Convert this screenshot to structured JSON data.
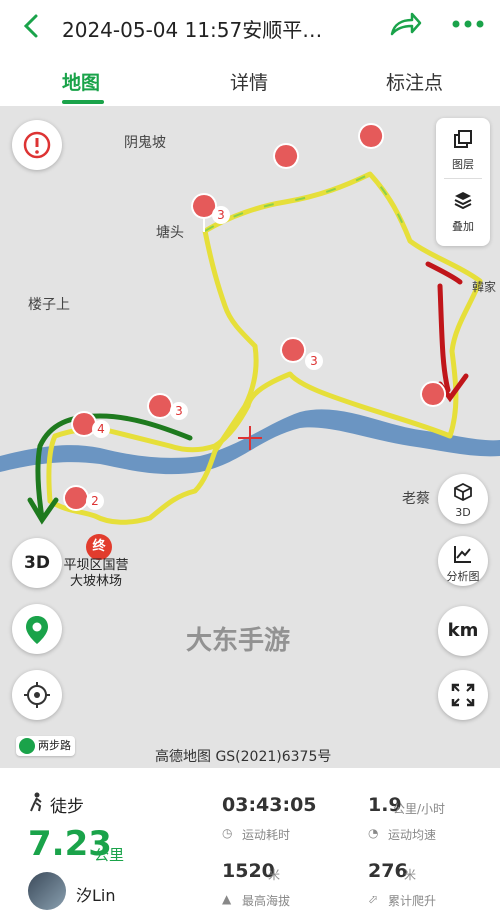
{
  "header": {
    "title": "2024-05-04 11:57安顺平…",
    "back_icon": "chevron-left-icon",
    "share_icon": "share-arrow-icon",
    "more_icon": "more-dots-icon",
    "accent": "#1aa34a"
  },
  "tabs": [
    {
      "label": "地图",
      "active": true
    },
    {
      "label": "详情",
      "active": false
    },
    {
      "label": "标注点",
      "active": false
    }
  ],
  "map": {
    "places": {
      "yinguipo": "阴鬼坡",
      "tangtou": "塘头",
      "louzishang": "楼子上",
      "laocai": "老蔡",
      "jia": "韓家"
    },
    "end_badge": "终",
    "farm_label_line1": "平坝区国营",
    "farm_label_line2": "大坡林场",
    "marker_counts": {
      "m1": "3",
      "m2": "3",
      "m3": "3",
      "m4": "4",
      "m5": "2"
    },
    "layers": {
      "layer_label": "图层",
      "overlay_label": "叠加"
    },
    "right_buttons": {
      "three_d": "3D",
      "analysis": "分析图",
      "km": "km"
    },
    "left_buttons": {
      "three_d_left": "3D"
    },
    "two_step_road": "两步路",
    "watermark": "大东手游",
    "attribution": "高德地图 GS(2021)6375号"
  },
  "stats": {
    "activity": "徒步",
    "distance": "7.23",
    "distance_unit": "公里",
    "moving_time": "03:43:05",
    "moving_time_label": "运动耗时",
    "avg_speed": "1.9",
    "avg_speed_unit": "公里/小时",
    "avg_speed_label": "运动均速",
    "max_alt": "1520",
    "max_alt_unit": "米",
    "max_alt_label": "最高海拔",
    "climb": "276",
    "climb_unit": "米",
    "climb_label": "累计爬升",
    "username": "汐Lin"
  }
}
